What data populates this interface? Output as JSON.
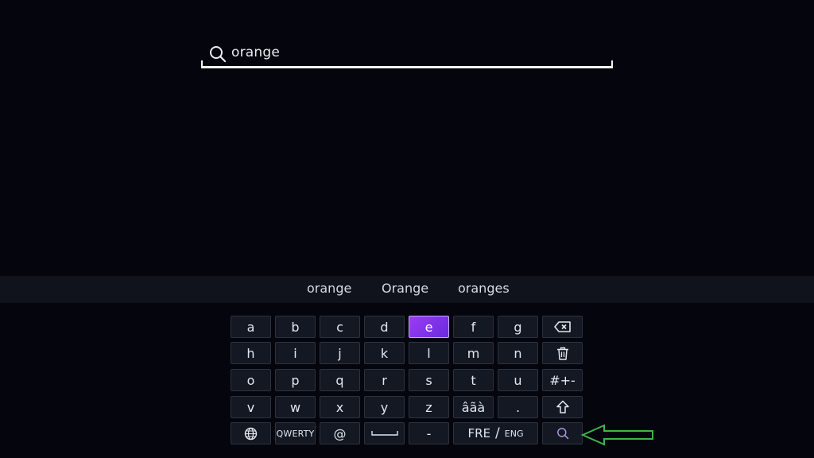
{
  "search": {
    "query": "orange",
    "icon": "search-icon"
  },
  "suggestions": [
    "orange",
    "Orange",
    "oranges"
  ],
  "keyboard": {
    "active_key": "e",
    "rows": [
      [
        "a",
        "b",
        "c",
        "d",
        "e",
        "f",
        "g",
        "⌫"
      ],
      [
        "h",
        "i",
        "j",
        "k",
        "l",
        "m",
        "n",
        "🗑"
      ],
      [
        "o",
        "p",
        "q",
        "r",
        "s",
        "t",
        "u",
        "#+-"
      ],
      [
        "v",
        "w",
        "x",
        "y",
        "z",
        "âãà",
        ".",
        "⇧"
      ]
    ],
    "bottom_row": {
      "language_icon": "globe-icon",
      "layout_label": "QWERTY",
      "at_label": "@",
      "space_icon": "space-bar-icon",
      "dash_label": "-",
      "lang_primary": "FRE",
      "lang_slash": "/",
      "lang_secondary": "ENG",
      "search_icon": "search-icon"
    }
  },
  "annotation": {
    "arrow_color": "#3fb54a",
    "icon": "arrow-left-icon"
  },
  "colors": {
    "background": "#05060d",
    "key_bg": "#141822",
    "active_key": "#8a34ea",
    "suggestion_band": "#10131c"
  }
}
